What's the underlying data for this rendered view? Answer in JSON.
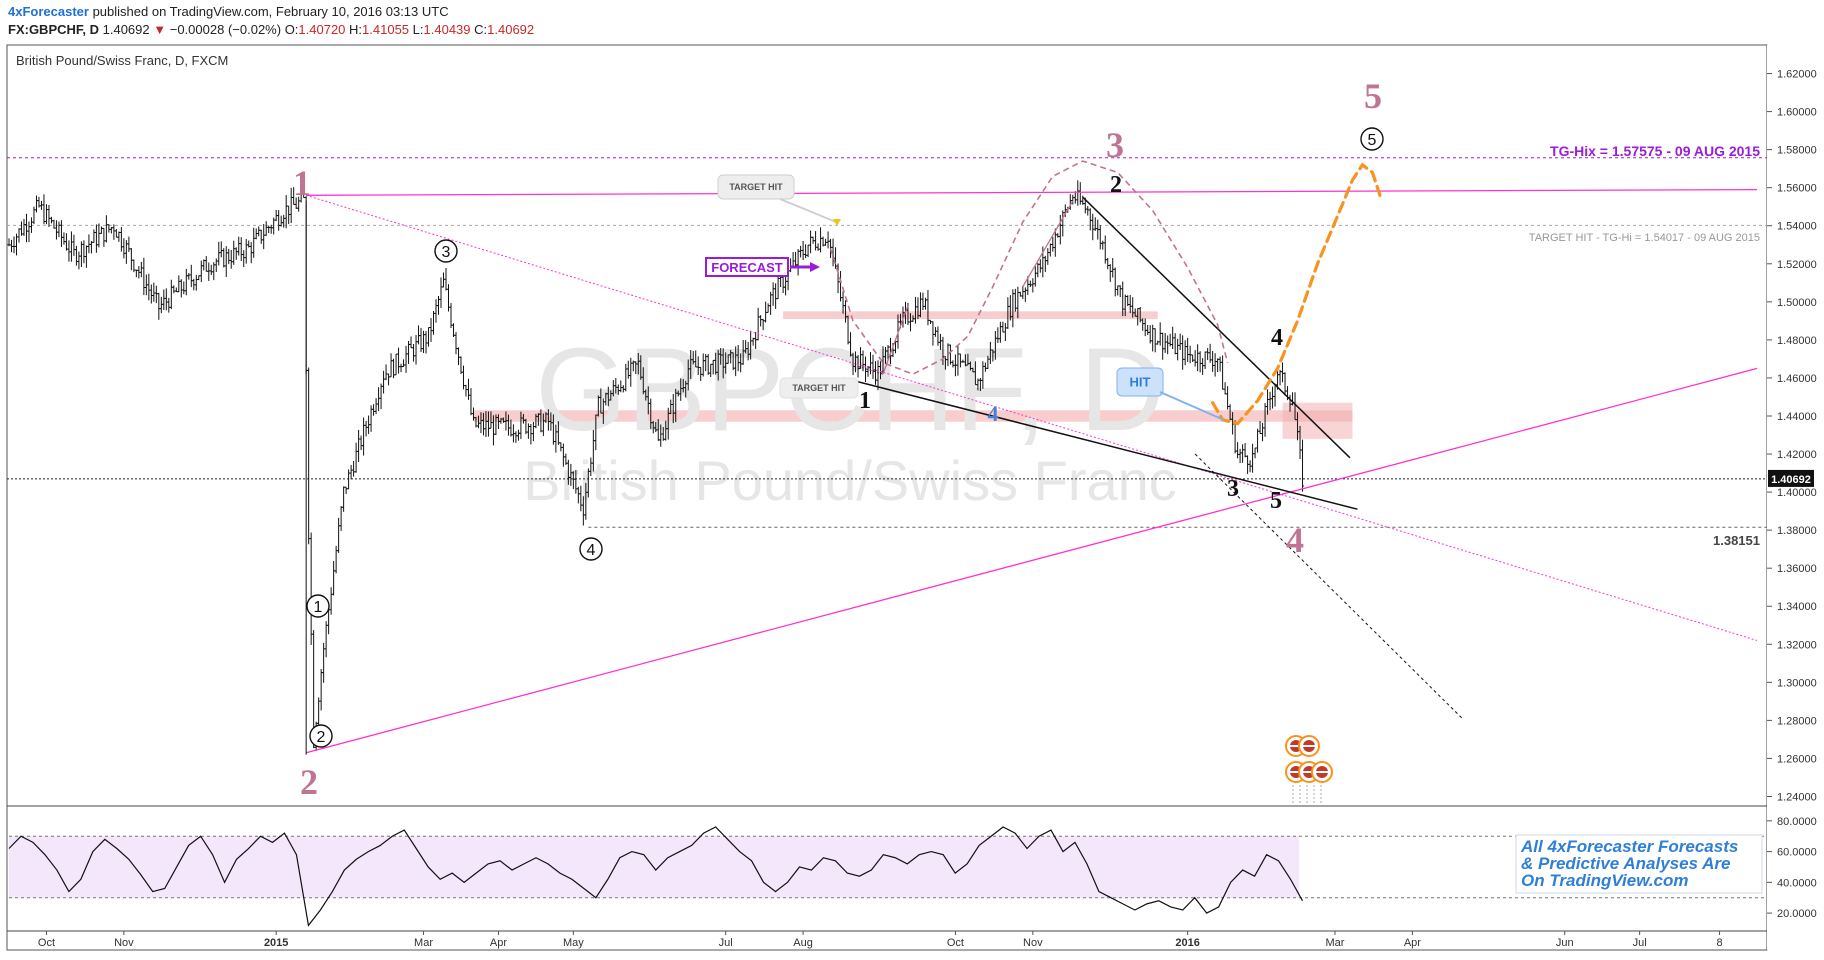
{
  "header": {
    "publisher": "4xForecaster",
    "published_text": " published on TradingView.com, February 10, 2016 03:13 UTC",
    "symbol": "FX:GBPCHF, D",
    "last": "1.40692",
    "change": "−0.00028 (−0.02%)",
    "open_label": "O:",
    "open": "1.40720",
    "high_label": "H:",
    "high": "1.41055",
    "low_label": "L:",
    "low": "1.40439",
    "close_label": "C:",
    "close": "1.40692"
  },
  "chart_data": {
    "type": "bar",
    "instrument": "British Pound/Swiss Franc, D, FXCM",
    "watermark_symbol": "GBPCHF, D",
    "watermark_name": "British Pound/Swiss Franc",
    "price_axis": {
      "ylim": [
        1.235,
        1.635
      ],
      "ticks": [
        "1.62000",
        "1.60000",
        "1.58000",
        "1.56000",
        "1.54000",
        "1.52000",
        "1.50000",
        "1.48000",
        "1.46000",
        "1.44000",
        "1.42000",
        "1.40000",
        "1.38000",
        "1.36000",
        "1.34000",
        "1.32000",
        "1.30000",
        "1.28000",
        "1.26000",
        "1.24000"
      ],
      "current_price_label": "1.40692"
    },
    "time_axis": {
      "ticks": [
        {
          "label": "Oct",
          "t": 15
        },
        {
          "label": "Nov",
          "t": 46
        },
        {
          "label": "2015",
          "t": 107
        },
        {
          "label": "Mar",
          "t": 166
        },
        {
          "label": "Apr",
          "t": 196
        },
        {
          "label": "May",
          "t": 226
        },
        {
          "label": "Jul",
          "t": 287
        },
        {
          "label": "Aug",
          "t": 318
        },
        {
          "label": "Oct",
          "t": 379
        },
        {
          "label": "Nov",
          "t": 410
        },
        {
          "label": "2016",
          "t": 472
        },
        {
          "label": "Mar",
          "t": 531
        },
        {
          "label": "Apr",
          "t": 562
        },
        {
          "label": "Jun",
          "t": 623
        },
        {
          "label": "Jul",
          "t": 653
        },
        {
          "label": "8",
          "t": 685
        }
      ]
    },
    "anchors": [
      {
        "t": 0,
        "p": 1.53
      },
      {
        "t": 12,
        "p": 1.55
      },
      {
        "t": 26,
        "p": 1.525
      },
      {
        "t": 42,
        "p": 1.54
      },
      {
        "t": 60,
        "p": 1.497
      },
      {
        "t": 80,
        "p": 1.52
      },
      {
        "t": 96,
        "p": 1.528
      },
      {
        "t": 110,
        "p": 1.548
      },
      {
        "t": 118,
        "p": 1.553
      },
      {
        "t": 120,
        "p": 1.38
      },
      {
        "t": 122,
        "p": 1.27
      },
      {
        "t": 126,
        "p": 1.318
      },
      {
        "t": 134,
        "p": 1.4
      },
      {
        "t": 150,
        "p": 1.462
      },
      {
        "t": 168,
        "p": 1.482
      },
      {
        "t": 174,
        "p": 1.51
      },
      {
        "t": 186,
        "p": 1.435
      },
      {
        "t": 200,
        "p": 1.434
      },
      {
        "t": 216,
        "p": 1.437
      },
      {
        "t": 230,
        "p": 1.392
      },
      {
        "t": 236,
        "p": 1.445
      },
      {
        "t": 252,
        "p": 1.467
      },
      {
        "t": 260,
        "p": 1.426
      },
      {
        "t": 272,
        "p": 1.465
      },
      {
        "t": 294,
        "p": 1.47
      },
      {
        "t": 304,
        "p": 1.5
      },
      {
        "t": 320,
        "p": 1.53
      },
      {
        "t": 328,
        "p": 1.535
      },
      {
        "t": 338,
        "p": 1.47
      },
      {
        "t": 348,
        "p": 1.463
      },
      {
        "t": 358,
        "p": 1.49
      },
      {
        "t": 366,
        "p": 1.5
      },
      {
        "t": 374,
        "p": 1.475
      },
      {
        "t": 388,
        "p": 1.458
      },
      {
        "t": 402,
        "p": 1.5
      },
      {
        "t": 414,
        "p": 1.52
      },
      {
        "t": 426,
        "p": 1.556
      },
      {
        "t": 432,
        "p": 1.548
      },
      {
        "t": 438,
        "p": 1.53
      },
      {
        "t": 446,
        "p": 1.5
      },
      {
        "t": 458,
        "p": 1.483
      },
      {
        "t": 472,
        "p": 1.472
      },
      {
        "t": 484,
        "p": 1.47
      },
      {
        "t": 492,
        "p": 1.42
      },
      {
        "t": 498,
        "p": 1.418
      },
      {
        "t": 508,
        "p": 1.463
      },
      {
        "t": 514,
        "p": 1.448
      },
      {
        "t": 518,
        "p": 1.407
      }
    ],
    "rsi": {
      "ticks": [
        "80.0000",
        "60.0000",
        "40.0000",
        "20.0000"
      ],
      "upper_band": 70,
      "lower_band": 30,
      "ylim": [
        9,
        89
      ],
      "values": [
        62,
        70,
        66,
        58,
        48,
        34,
        42,
        60,
        68,
        62,
        55,
        45,
        34,
        36,
        50,
        64,
        70,
        58,
        40,
        55,
        62,
        70,
        66,
        72,
        58,
        12,
        22,
        34,
        48,
        55,
        60,
        64,
        70,
        74,
        62,
        50,
        42,
        46,
        40,
        46,
        52,
        54,
        48,
        52,
        56,
        52,
        46,
        42,
        36,
        30,
        42,
        56,
        60,
        58,
        48,
        56,
        60,
        64,
        72,
        76,
        68,
        60,
        54,
        40,
        34,
        40,
        50,
        48,
        56,
        54,
        46,
        44,
        48,
        58,
        56,
        52,
        58,
        60,
        58,
        46,
        52,
        64,
        70,
        76,
        72,
        62,
        70,
        74,
        60,
        66,
        52,
        34,
        30,
        26,
        22,
        26,
        28,
        24,
        22,
        30,
        20,
        24,
        40,
        48,
        44,
        58,
        54,
        42,
        28
      ]
    },
    "annotations": {
      "target_hit": "TARGET HIT",
      "forecast": "FORECAST",
      "hit": "HIT",
      "tg_hix": "TG-Hix = 1.57575 - 09 AUG 2015",
      "tg_hi": "TARGET HIT - TG-Hi = 1.54017 - 09 AUG 2015",
      "level_1_38151": "1.38151",
      "promo_1": "All 4xForecaster Forecasts",
      "promo_2": "& Predictive Analyses Are",
      "promo_3": "On TradingView.com",
      "wave_labels": {
        "big_1": "1",
        "big_2": "2",
        "big_3": "3",
        "big_4": "4",
        "big_5": "5",
        "circ_1": "1",
        "circ_2": "2",
        "circ_3": "3",
        "circ_4": "4",
        "circ_5": "5",
        "blk_1": "1",
        "blk_2": "2",
        "blk_3": "3",
        "blk_4": "4",
        "blk_5": "5",
        "blue_4": "4"
      }
    },
    "colors": {
      "magenta": "#ff33cc",
      "wave_purple": "#c07494",
      "orange": "#f7931e",
      "zone": "#f4b8b8",
      "rsi_fill": "#f4e6fb",
      "violet": "#9b1cd8"
    }
  }
}
